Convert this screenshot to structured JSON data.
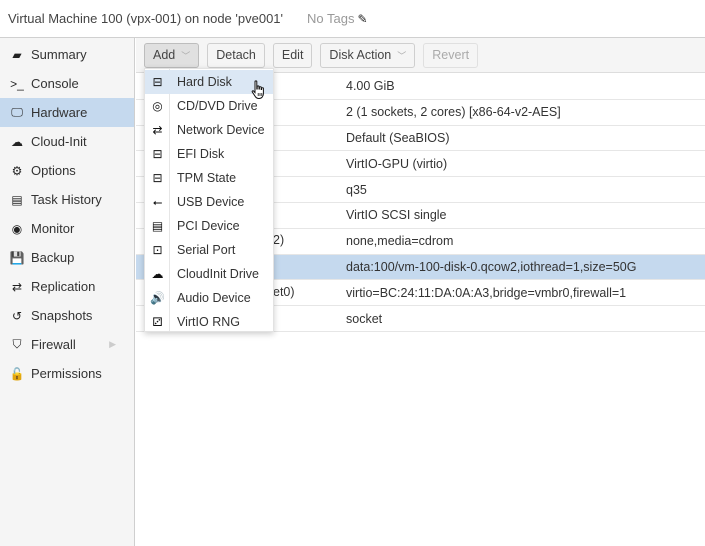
{
  "header": {
    "title": "Virtual Machine 100 (vpx-001) on node 'pve001'",
    "tags": "No Tags",
    "edit_tags_icon": "pencil-icon"
  },
  "sidebar": {
    "items": [
      {
        "label": "Summary",
        "icon": "book-icon",
        "glyph": "▰"
      },
      {
        "label": "Console",
        "icon": "terminal-icon",
        "glyph": ">_"
      },
      {
        "label": "Hardware",
        "icon": "desktop-icon",
        "glyph": "🖵",
        "active": true
      },
      {
        "label": "Cloud-Init",
        "icon": "cloud-icon",
        "glyph": "☁"
      },
      {
        "label": "Options",
        "icon": "gear-icon",
        "glyph": "⚙"
      },
      {
        "label": "Task History",
        "icon": "list-icon",
        "glyph": "▤"
      },
      {
        "label": "Monitor",
        "icon": "eye-icon",
        "glyph": "◉"
      },
      {
        "label": "Backup",
        "icon": "floppy-icon",
        "glyph": "💾"
      },
      {
        "label": "Replication",
        "icon": "retweet-icon",
        "glyph": "⇄"
      },
      {
        "label": "Snapshots",
        "icon": "history-icon",
        "glyph": "↺"
      },
      {
        "label": "Firewall",
        "icon": "shield-icon",
        "glyph": "⛉",
        "expandable": true
      },
      {
        "label": "Permissions",
        "icon": "unlock-icon",
        "glyph": "🔓"
      }
    ]
  },
  "toolbar": {
    "add": "Add",
    "detach": "Detach",
    "edit": "Edit",
    "disk_action": "Disk Action",
    "revert": "Revert"
  },
  "hardware_rows": [
    {
      "key_visible": "",
      "value": "4.00 GiB"
    },
    {
      "key_visible": "",
      "value": "2 (1 sockets, 2 cores) [x86-64-v2-AES]"
    },
    {
      "key_visible": "",
      "value": "Default (SeaBIOS)"
    },
    {
      "key_visible": "",
      "value": "VirtIO-GPU (virtio)"
    },
    {
      "key_visible": "",
      "value": "q35"
    },
    {
      "key_visible": "",
      "value": "VirtIO SCSI single"
    },
    {
      "key_visible": "2)",
      "value": "none,media=cdrom"
    },
    {
      "key_visible": "",
      "value": "data:100/vm-100-disk-0.qcow2,iothread=1,size=50G",
      "selected": true
    },
    {
      "key_visible": "et0)",
      "value": "virtio=BC:24:11:DA:0A:A3,bridge=vmbr0,firewall=1"
    },
    {
      "key_visible": "",
      "value": "socket"
    }
  ],
  "add_menu": {
    "items": [
      {
        "label": "Hard Disk",
        "icon": "hdd-icon",
        "glyph": "⊟",
        "hover": true
      },
      {
        "label": "CD/DVD Drive",
        "icon": "cdrom-icon",
        "glyph": "◎"
      },
      {
        "label": "Network Device",
        "icon": "exchange-icon",
        "glyph": "⇄"
      },
      {
        "label": "EFI Disk",
        "icon": "hdd-icon",
        "glyph": "⊟"
      },
      {
        "label": "TPM State",
        "icon": "hdd-icon",
        "glyph": "⊟"
      },
      {
        "label": "USB Device",
        "icon": "usb-icon",
        "glyph": "⭠"
      },
      {
        "label": "PCI Device",
        "icon": "pci-card-icon",
        "glyph": "▤"
      },
      {
        "label": "Serial Port",
        "icon": "serial-port-icon",
        "glyph": "⊡"
      },
      {
        "label": "CloudInit Drive",
        "icon": "cloud-icon",
        "glyph": "☁"
      },
      {
        "label": "Audio Device",
        "icon": "volume-icon",
        "glyph": "🔊"
      },
      {
        "label": "VirtIO RNG",
        "icon": "dice-icon",
        "glyph": "⚂"
      }
    ]
  },
  "colors": {
    "selection": "#c5d9ee",
    "menu_hover": "#dbe7f4",
    "sidebar_bg": "#f5f5f5"
  }
}
